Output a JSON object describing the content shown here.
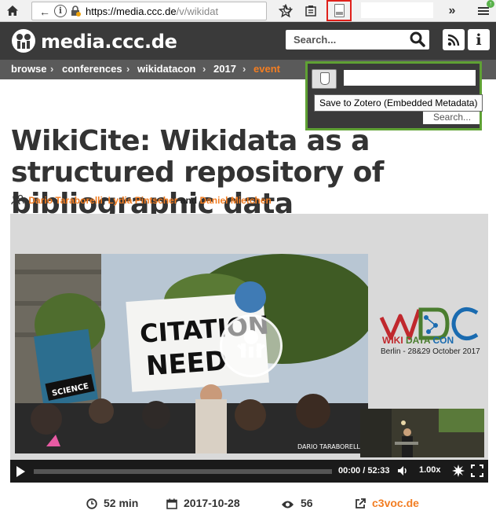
{
  "browser": {
    "url_domain": "https://media.ccc.de",
    "url_path": "/v/wikidat"
  },
  "zotero": {
    "tooltip": "Save to Zotero (Embedded Metadata)"
  },
  "site": {
    "name": "media.ccc.de",
    "search_placeholder": "Search...",
    "search_placeholder_secondary": "Search..."
  },
  "breadcrumb": {
    "items": [
      "browse",
      "conferences",
      "wikidatacon",
      "2017"
    ],
    "active": "event",
    "separator": "›"
  },
  "talk": {
    "title": "WikiCite: Wikidata as a structured repository of bibliographic data",
    "persons": [
      "Dario Taraborelli",
      "Lydia Pintscher",
      "Daniel Mietchen"
    ],
    "persons_separator": ",",
    "persons_and": "and"
  },
  "player": {
    "slide_wiki": "WIKI",
    "slide_data": "DATA",
    "slide_con": "CON",
    "slide_subtitle": "Berlin - 28&29 October 2017",
    "photo_credit": "DARIO TARABORELLI /C",
    "time_current": "00:00",
    "time_total": "52:33",
    "time_sep": "/",
    "speed": "1.00x",
    "sign_citation": "CITATION",
    "sign_needed": "NEED",
    "sign_science": "SCIENCE",
    "progress": 0
  },
  "stats": {
    "duration": "52 min",
    "date": "2017-10-28",
    "views": "56",
    "source": "c3voc.de"
  },
  "colors": {
    "accent": "#f27d22",
    "header_bg": "#3a3a3a",
    "breadcrumb_bg": "#5a5a5a",
    "popup_border": "#5fa134",
    "highlight_red": "#e0201b"
  }
}
